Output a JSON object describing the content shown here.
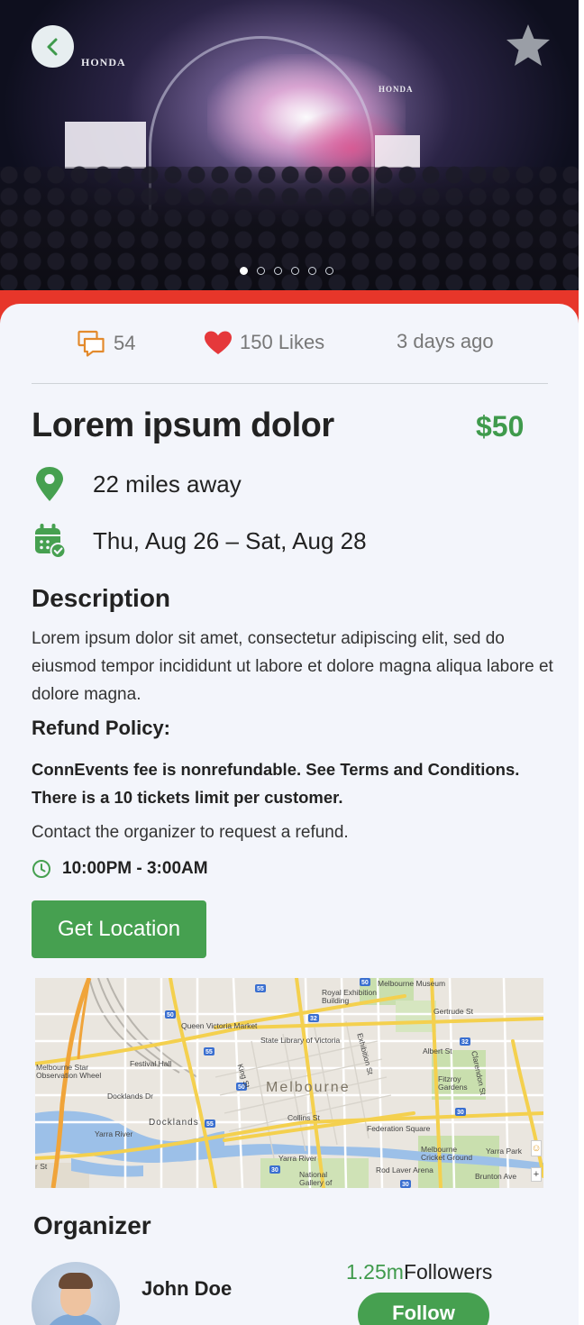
{
  "hero": {
    "sign_left": "HONDA",
    "sign_right": "HONDA",
    "carousel_total": 6,
    "carousel_active": 1
  },
  "stats": {
    "comments": "54",
    "likes": "150 Likes",
    "posted": "3 days ago"
  },
  "event": {
    "title": "Lorem ipsum dolor",
    "price": "$50",
    "distance": "22 miles away",
    "dates": "Thu, Aug 26 – Sat, Aug 28"
  },
  "description": {
    "heading": "Description",
    "body": "Lorem ipsum dolor sit amet, consectetur adipiscing elit, sed do eiusmod tempor incididunt ut labore et dolore magna aliqua labore et dolore magna."
  },
  "refund": {
    "heading": "Refund Policy:",
    "policy": "ConnEvents fee is nonrefundable. See Terms and Conditions. There is a 10 tickets limit per customer.",
    "contact": "Contact the organizer to request a refund."
  },
  "time": "10:00PM - 3:00AM",
  "location_button": "Get Location",
  "map": {
    "city": "Melbourne",
    "labels": {
      "museum": "Melbourne Museum",
      "royal": "Royal Exhibition Building",
      "gertrude": "Gertrude St",
      "queen_vic": "Queen Victoria Market",
      "library": "State Library of Victoria",
      "albert": "Albert St",
      "star": "Melbourne Star Observation Wheel",
      "festival": "Festival Hall",
      "fitzroy": "Fitzroy Gardens",
      "docklands_dr": "Docklands Dr",
      "docklands": "Docklands",
      "collins": "Collins St",
      "yarra_river": "Yarra River",
      "yarra_river2": "Yarra River",
      "federation": "Federation Square",
      "cricket": "Melbourne Cricket Ground",
      "yarra_park": "Yarra Park",
      "gallery": "National Gallery of Victoria",
      "rod_laver": "Rod Laver Arena",
      "brunton": "Brunton Ave",
      "exhibition": "Exhibition St",
      "king": "King St",
      "clarendon": "Clarendon St",
      "r_st": "r St"
    },
    "controls": {
      "pegman": "☺",
      "zoom_in": "+"
    }
  },
  "organizer": {
    "heading": "Organizer",
    "name": "John Doe",
    "followers_count": "1.25m",
    "followers_label": "Followers",
    "follow_button": "Follow"
  },
  "colors": {
    "accent_green": "#46a050",
    "price_green": "#3f9a4c",
    "hero_red": "#e7362a",
    "comment_orange": "#e38a2d",
    "heart_red": "#e5383b",
    "card_bg": "#f3f5fb"
  },
  "icons": {
    "back": "chevron-left-icon",
    "favorite": "star-icon",
    "comments": "comment-icon",
    "likes": "heart-icon",
    "location": "map-pin-icon",
    "calendar": "calendar-check-icon",
    "clock": "clock-icon"
  }
}
